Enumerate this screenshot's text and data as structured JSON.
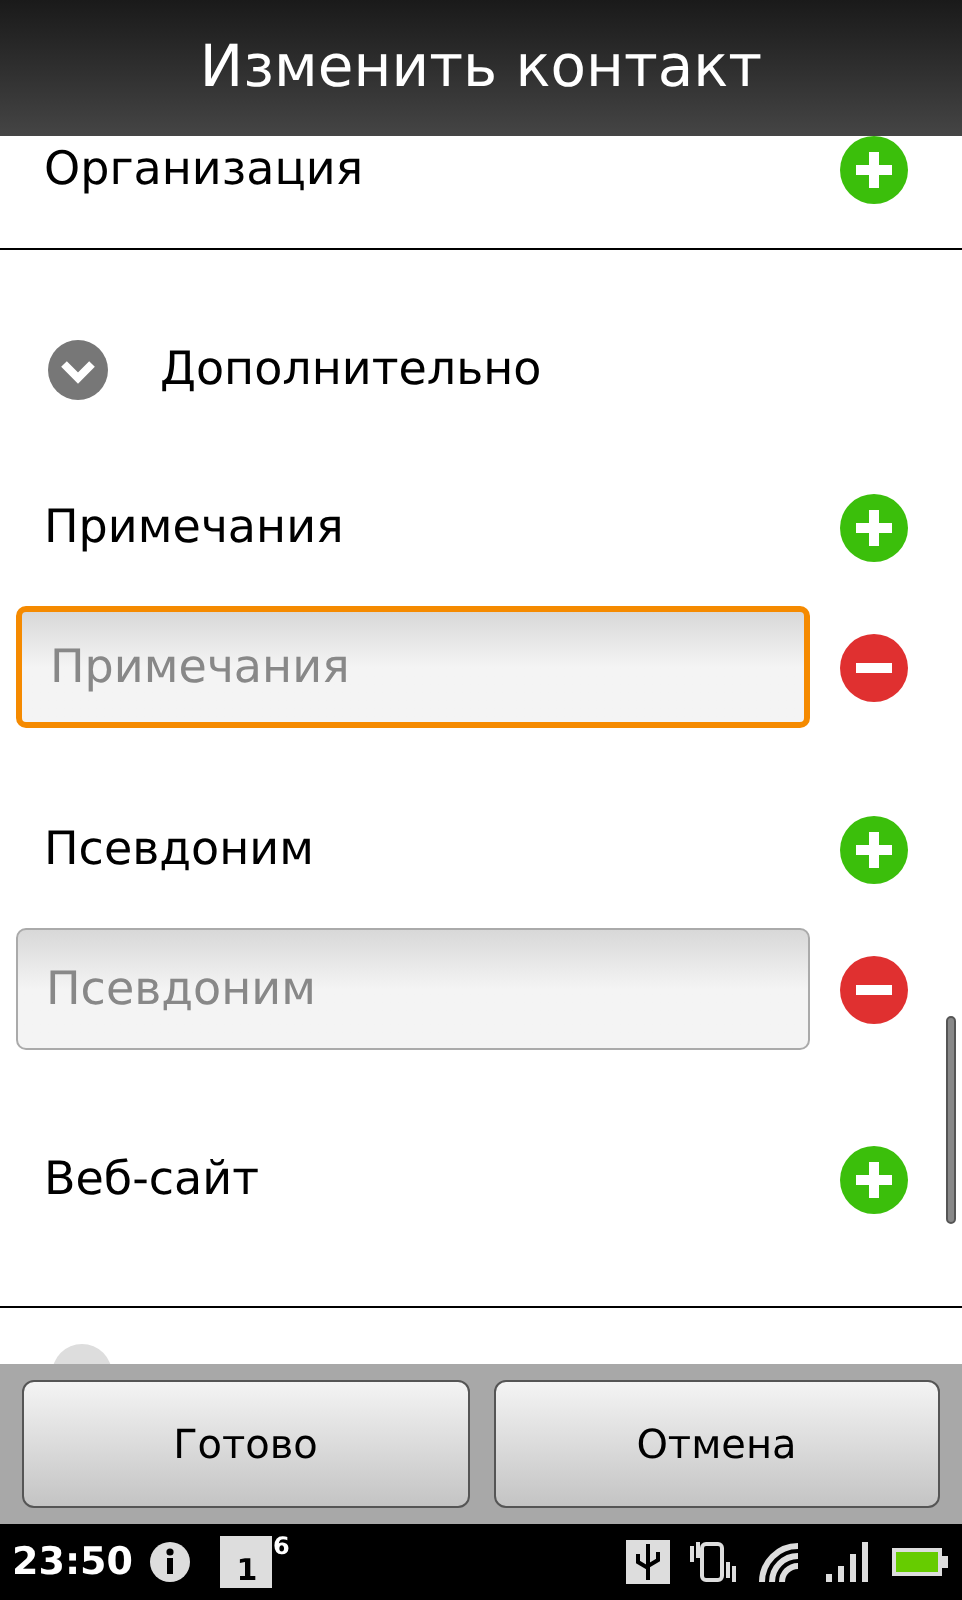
{
  "title_bar": {
    "title": "Изменить контакт"
  },
  "sections": [
    {
      "kind": "field_group",
      "label": "Организация"
    },
    {
      "kind": "expander",
      "label": "Дополнительно",
      "expanded": true
    },
    {
      "kind": "field_group",
      "label": "Примечания",
      "fields": [
        {
          "placeholder": "Примечания",
          "focused": true
        }
      ]
    },
    {
      "kind": "field_group",
      "label": "Псевдоним",
      "fields": [
        {
          "placeholder": "Псевдоним",
          "focused": false
        }
      ]
    },
    {
      "kind": "field_group",
      "label": "Веб-сайт"
    }
  ],
  "buttons": [
    {
      "label": "Готово"
    },
    {
      "label": "Отмена"
    }
  ],
  "status_bar": {
    "time": "23:50",
    "calendar_day": "1",
    "notification_count": "6"
  }
}
